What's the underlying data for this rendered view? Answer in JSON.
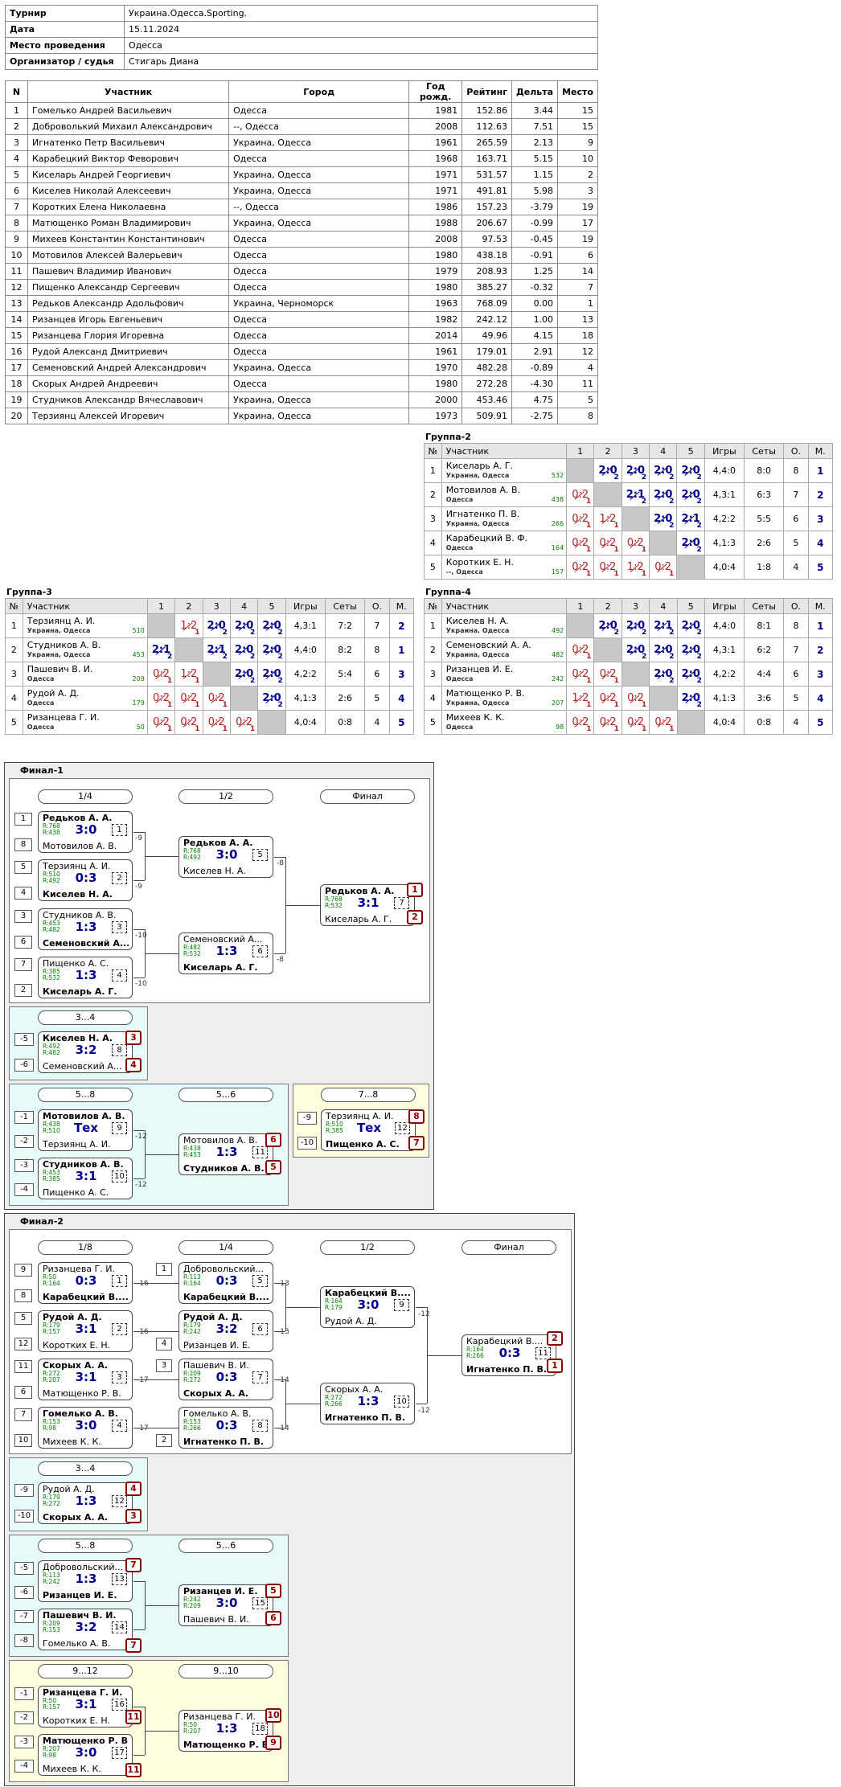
{
  "info": [
    {
      "k": "Турнир",
      "v": "Украина.Одесса.Sporting."
    },
    {
      "k": "Дата",
      "v": "15.11.2024"
    },
    {
      "k": "Место проведения",
      "v": "Одесса"
    },
    {
      "k": "Организатор / судья",
      "v": "Стигарь Диана"
    }
  ],
  "participants": {
    "headers": [
      "N",
      "Участник",
      "Город",
      "Год рожд.",
      "Рейтинг",
      "Дельта",
      "Место"
    ],
    "rows": [
      [
        "1",
        "Гомелько Андрей Васильевич",
        "Одесса",
        "1981",
        "152.86",
        "3.44",
        "15"
      ],
      [
        "2",
        "Доброволький Михаил Александрович",
        "--, Одесса",
        "2008",
        "112.63",
        "7.51",
        "15"
      ],
      [
        "3",
        "Игнатенко Петр Васильевич",
        "Украина, Одесса",
        "1961",
        "265.59",
        "2.13",
        "9"
      ],
      [
        "4",
        "Карабецкий Виктор Феворович",
        "Одесса",
        "1968",
        "163.71",
        "5.15",
        "10"
      ],
      [
        "5",
        "Киселарь Андрей Георгиевич",
        "Украина, Одесса",
        "1971",
        "531.57",
        "1.15",
        "2"
      ],
      [
        "6",
        "Киселев Николай Алексеевич",
        "Украина, Одесса",
        "1971",
        "491.81",
        "5.98",
        "3"
      ],
      [
        "7",
        "Коротких Елена Николаевна",
        "--, Одесса",
        "1986",
        "157.23",
        "-3.79",
        "19"
      ],
      [
        "8",
        "Матющенко Роман Владимирович",
        "Украина, Одесса",
        "1988",
        "206.67",
        "-0.99",
        "17"
      ],
      [
        "9",
        "Михеев Константин Константинович",
        "Одесса",
        "2008",
        "97.53",
        "-0.45",
        "19"
      ],
      [
        "10",
        "Мотовилов Алексей Валерьевич",
        "Одесса",
        "1980",
        "438.18",
        "-0.91",
        "6"
      ],
      [
        "11",
        "Пашевич Владимир Иванович",
        "Одесса",
        "1979",
        "208.93",
        "1.25",
        "14"
      ],
      [
        "12",
        "Пищенко Александр Сергеевич",
        "Одесса",
        "1980",
        "385.27",
        "-0.32",
        "7"
      ],
      [
        "13",
        "Редьков Александр Адольфович",
        "Украина, Черноморск",
        "1963",
        "768.09",
        "0.00",
        "1"
      ],
      [
        "14",
        "Ризанцев Игорь Евгеньевич",
        "Одесса",
        "1982",
        "242.12",
        "1.00",
        "13"
      ],
      [
        "15",
        "Ризанцева Глория Игоревна",
        "Одесса",
        "2014",
        "49.96",
        "4.15",
        "18"
      ],
      [
        "16",
        "Рудой Александ Дмитриевич",
        "Одесса",
        "1961",
        "179.01",
        "2.91",
        "12"
      ],
      [
        "17",
        "Семеновский Андрей Александрович",
        "Украина, Одесса",
        "1970",
        "482.28",
        "-0.89",
        "4"
      ],
      [
        "18",
        "Скорых Андрей Андреевич",
        "Одесса",
        "1980",
        "272.28",
        "-4.30",
        "11"
      ],
      [
        "19",
        "Студников Александр Вячеславович",
        "Украина, Одесса",
        "2000",
        "453.46",
        "4.75",
        "5"
      ],
      [
        "20",
        "Терзиянц Алексей Игоревич",
        "Украина, Одесса",
        "1973",
        "509.91",
        "-2.75",
        "8"
      ]
    ]
  },
  "group_headers": [
    "№",
    "Участник",
    "1",
    "2",
    "3",
    "4",
    "5",
    "Игры",
    "Сеты",
    "О.",
    "М."
  ],
  "groups": [
    {
      "title": "Группа-2",
      "rows": [
        {
          "n": "1",
          "name": "Киселарь А. Г.",
          "city": "Украина, Одесса",
          "rating": "532",
          "res": [
            "",
            "2:0|2|w",
            "2:0|2|w",
            "2:0|2|w",
            "2:0|2|w"
          ],
          "games": "4,4:0",
          "sets": "8:0",
          "pts": "8",
          "place": "1"
        },
        {
          "n": "2",
          "name": "Мотовилов А. В.",
          "city": "Одесса",
          "rating": "438",
          "res": [
            "0:2|1|l",
            "",
            "2:1|2|w",
            "2:0|2|w",
            "2:0|2|w"
          ],
          "games": "4,3:1",
          "sets": "6:3",
          "pts": "7",
          "place": "2"
        },
        {
          "n": "3",
          "name": "Игнатенко П. В.",
          "city": "Украина, Одесса",
          "rating": "266",
          "res": [
            "0:2|1|l",
            "1:2|1|l",
            "",
            "2:0|2|w",
            "2:1|2|w"
          ],
          "games": "4,2:2",
          "sets": "5:5",
          "pts": "6",
          "place": "3"
        },
        {
          "n": "4",
          "name": "Карабецкий В. Ф.",
          "city": "Одесса",
          "rating": "164",
          "res": [
            "0:2|1|l",
            "0:2|1|l",
            "0:2|1|l",
            "",
            "2:0|2|w"
          ],
          "games": "4,1:3",
          "sets": "2:6",
          "pts": "5",
          "place": "4"
        },
        {
          "n": "5",
          "name": "Коротких Е. Н.",
          "city": "--, Одесса",
          "rating": "157",
          "res": [
            "0:2|1|l",
            "0:2|1|l",
            "1:2|1|l",
            "0:2|1|l",
            ""
          ],
          "games": "4,0:4",
          "sets": "1:8",
          "pts": "4",
          "place": "5"
        }
      ]
    },
    {
      "title": "Группа-3",
      "rows": [
        {
          "n": "1",
          "name": "Терзиянц А. И.",
          "city": "Украина, Одесса",
          "rating": "510",
          "res": [
            "",
            "1:2|1|l",
            "2:0|2|w",
            "2:0|2|w",
            "2:0|2|w"
          ],
          "games": "4,3:1",
          "sets": "7:2",
          "pts": "7",
          "place": "2"
        },
        {
          "n": "2",
          "name": "Студников А. В.",
          "city": "Украина, Одесса",
          "rating": "453",
          "res": [
            "2:1|2|w",
            "",
            "2:1|2|w",
            "2:0|2|w",
            "2:0|2|w"
          ],
          "games": "4,4:0",
          "sets": "8:2",
          "pts": "8",
          "place": "1"
        },
        {
          "n": "3",
          "name": "Пашевич В. И.",
          "city": "Одесса",
          "rating": "209",
          "res": [
            "0:2|1|l",
            "1:2|1|l",
            "",
            "2:0|2|w",
            "2:0|2|w"
          ],
          "games": "4,2:2",
          "sets": "5:4",
          "pts": "6",
          "place": "3"
        },
        {
          "n": "4",
          "name": "Рудой А. Д.",
          "city": "Одесса",
          "rating": "179",
          "res": [
            "0:2|1|l",
            "0:2|1|l",
            "0:2|1|l",
            "",
            "2:0|2|w"
          ],
          "games": "4,1:3",
          "sets": "2:6",
          "pts": "5",
          "place": "4"
        },
        {
          "n": "5",
          "name": "Ризанцева Г. И.",
          "city": "Одесса",
          "rating": "50",
          "res": [
            "0:2|1|l",
            "0:2|1|l",
            "0:2|1|l",
            "0:2|1|l",
            ""
          ],
          "games": "4,0:4",
          "sets": "0:8",
          "pts": "4",
          "place": "5"
        }
      ]
    },
    {
      "title": "Группа-4",
      "rows": [
        {
          "n": "1",
          "name": "Киселев Н. А.",
          "city": "Украина, Одесса",
          "rating": "492",
          "res": [
            "",
            "2:0|2|w",
            "2:0|2|w",
            "2:1|2|w",
            "2:0|2|w"
          ],
          "games": "4,4:0",
          "sets": "8:1",
          "pts": "8",
          "place": "1"
        },
        {
          "n": "2",
          "name": "Семеновский А. А.",
          "city": "Украина, Одесса",
          "rating": "482",
          "res": [
            "0:2|1|l",
            "",
            "2:0|2|w",
            "2:0|2|w",
            "2:0|2|w"
          ],
          "games": "4,3:1",
          "sets": "6:2",
          "pts": "7",
          "place": "2"
        },
        {
          "n": "3",
          "name": "Ризанцев И. Е.",
          "city": "Одесса",
          "rating": "242",
          "res": [
            "0:2|1|l",
            "0:2|1|l",
            "",
            "2:0|2|w",
            "2:0|2|w"
          ],
          "games": "4,2:2",
          "sets": "4:4",
          "pts": "6",
          "place": "3"
        },
        {
          "n": "4",
          "name": "Матющенко Р. В.",
          "city": "Украина, Одесса",
          "rating": "207",
          "res": [
            "1:2|1|l",
            "0:2|1|l",
            "0:2|1|l",
            "",
            "2:0|2|w"
          ],
          "games": "4,1:3",
          "sets": "3:6",
          "pts": "5",
          "place": "4"
        },
        {
          "n": "5",
          "name": "Михеев К. К.",
          "city": "Одесса",
          "rating": "98",
          "res": [
            "0:2|1|l",
            "0:2|1|l",
            "0:2|1|l",
            "0:2|1|l",
            ""
          ],
          "games": "4,0:4",
          "sets": "0:8",
          "pts": "4",
          "place": "5"
        }
      ]
    }
  ],
  "final1": {
    "title": "Финал-1",
    "round_labels": [
      "1/4",
      "1/2",
      "Финал",
      "3...4",
      "5...8",
      "5...6",
      "7...8"
    ],
    "seeds": [
      "1",
      "8",
      "5",
      "4",
      "3",
      "6",
      "7",
      "2",
      "-5",
      "-6",
      "-1",
      "-2",
      "-3",
      "-4",
      "-9",
      "-10"
    ],
    "losers": [
      "-9",
      "-9",
      "-10",
      "-10",
      "-8",
      "-8",
      "-12",
      "-12"
    ],
    "places": [
      "1",
      "2",
      "3",
      "4",
      "6",
      "5",
      "8",
      "7"
    ],
    "matches": [
      {
        "p1": "Редьков А. А.",
        "r1": "R:768",
        "p2": "Мотовилов А. В.",
        "r2": "R:438",
        "score": "3:0",
        "num": "1",
        "w": 1
      },
      {
        "p1": "Терзиянц А. И.",
        "r1": "R:510",
        "p2": "Киселев Н. А.",
        "r2": "R:492",
        "score": "0:3",
        "num": "2",
        "w": 2
      },
      {
        "p1": "Студников А. В.",
        "r1": "R:453",
        "p2": "Семеновский А...",
        "r2": "R:482",
        "score": "1:3",
        "num": "3",
        "w": 2
      },
      {
        "p1": "Пищенко А. С.",
        "r1": "R:385",
        "p2": "Киселарь А. Г.",
        "r2": "R:532",
        "score": "1:3",
        "num": "4",
        "w": 2
      },
      {
        "p1": "Редьков А. А.",
        "r1": "R:768",
        "p2": "Киселев Н. А.",
        "r2": "R:492",
        "score": "3:0",
        "num": "5",
        "w": 1
      },
      {
        "p1": "Семеновский А...",
        "r1": "R:482",
        "p2": "Киселарь А. Г.",
        "r2": "R:532",
        "score": "1:3",
        "num": "6",
        "w": 2
      },
      {
        "p1": "Редьков А. А.",
        "r1": "R:768",
        "p2": "Киселарь А. Г.",
        "r2": "R:532",
        "score": "3:1",
        "num": "7",
        "w": 1
      },
      {
        "p1": "Киселев Н. А.",
        "r1": "R:492",
        "p2": "Семеновский А...",
        "r2": "R:482",
        "score": "3:2",
        "num": "8",
        "w": 1
      },
      {
        "p1": "Мотовилов А. В.",
        "r1": "R:438",
        "p2": "Терзиянц А. И.",
        "r2": "R:510",
        "score": "Тех",
        "num": "9",
        "w": 1
      },
      {
        "p1": "Студников А. В.",
        "r1": "R:453",
        "p2": "Пищенко А. С.",
        "r2": "R:385",
        "score": "3:1",
        "num": "10",
        "w": 1
      },
      {
        "p1": "Мотовилов А. В.",
        "r1": "R:438",
        "p2": "Студников А. В.",
        "r2": "R:453",
        "score": "1:3",
        "num": "11",
        "w": 2
      },
      {
        "p1": "Терзиянц А. И.",
        "r1": "R:510",
        "p2": "Пищенко А. С.",
        "r2": "R:385",
        "score": "Тех",
        "num": "12",
        "w": 2
      }
    ]
  },
  "final2": {
    "title": "Финал-2",
    "round_labels": [
      "1/8",
      "1/4",
      "1/2",
      "Финал",
      "3...4",
      "5...8",
      "5...6",
      "9...12",
      "9...10"
    ],
    "seeds": [
      "9",
      "8",
      "5",
      "12",
      "11",
      "6",
      "7",
      "10",
      "1",
      "4",
      "3",
      "2",
      "-9",
      "-10",
      "-5",
      "-6",
      "-7",
      "-8",
      "-1",
      "-2",
      "-3",
      "-4"
    ],
    "losers": [
      "-16",
      "-16",
      "-17",
      "-17",
      "-13",
      "-13",
      "-14",
      "-14",
      "-12",
      "-12"
    ],
    "places": [
      "2",
      "1",
      "4",
      "3",
      "7",
      "7",
      "5",
      "6",
      "11",
      "11",
      "10",
      "9"
    ],
    "matches": [
      {
        "p1": "Ризанцева Г. И.",
        "r1": "R:50",
        "p2": "Карабецкий В....",
        "r2": "R:164",
        "score": "0:3",
        "num": "1",
        "w": 2
      },
      {
        "p1": "Рудой А. Д.",
        "r1": "R:179",
        "p2": "Коротких Е. Н.",
        "r2": "R:157",
        "score": "3:1",
        "num": "2",
        "w": 1
      },
      {
        "p1": "Скорых А. А.",
        "r1": "R:272",
        "p2": "Матющенко Р. В.",
        "r2": "R:207",
        "score": "3:1",
        "num": "3",
        "w": 1
      },
      {
        "p1": "Гомелько А. В.",
        "r1": "R:153",
        "p2": "Михеев К. К.",
        "r2": "R:98",
        "score": "3:0",
        "num": "4",
        "w": 1
      },
      {
        "p1": "Добровольский...",
        "r1": "R:113",
        "p2": "Карабецкий В....",
        "r2": "R:164",
        "score": "0:3",
        "num": "5",
        "w": 2
      },
      {
        "p1": "Рудой А. Д.",
        "r1": "R:179",
        "p2": "Ризанцев И. Е.",
        "r2": "R:242",
        "score": "3:2",
        "num": "6",
        "w": 1
      },
      {
        "p1": "Пашевич В. И.",
        "r1": "R:209",
        "p2": "Скорых А. А.",
        "r2": "R:272",
        "score": "0:3",
        "num": "7",
        "w": 2
      },
      {
        "p1": "Гомелько А. В.",
        "r1": "R:153",
        "p2": "Игнатенко П. В.",
        "r2": "R:266",
        "score": "0:3",
        "num": "8",
        "w": 2
      },
      {
        "p1": "Карабецкий В....",
        "r1": "R:164",
        "p2": "Рудой А. Д.",
        "r2": "R:179",
        "score": "3:0",
        "num": "9",
        "w": 1
      },
      {
        "p1": "Скорых А. А.",
        "r1": "R:272",
        "p2": "Игнатенко П. В.",
        "r2": "R:266",
        "score": "1:3",
        "num": "10",
        "w": 2
      },
      {
        "p1": "Карабецкий В....",
        "r1": "R:164",
        "p2": "Игнатенко П. В.",
        "r2": "R:266",
        "score": "0:3",
        "num": "11",
        "w": 2
      },
      {
        "p1": "Рудой А. Д.",
        "r1": "R:179",
        "p2": "Скорых А. А.",
        "r2": "R:272",
        "score": "1:3",
        "num": "12",
        "w": 2
      },
      {
        "p1": "Добровольский...",
        "r1": "R:113",
        "p2": "Ризанцев И. Е.",
        "r2": "R:242",
        "score": "1:3",
        "num": "13",
        "w": 2
      },
      {
        "p1": "Пашевич В. И.",
        "r1": "R:209",
        "p2": "Гомелько А. В.",
        "r2": "R:153",
        "score": "3:2",
        "num": "14",
        "w": 1
      },
      {
        "p1": "Ризанцев И. Е.",
        "r1": "R:242",
        "p2": "Пашевич В. И.",
        "r2": "R:209",
        "score": "3:0",
        "num": "15",
        "w": 1
      },
      {
        "p1": "Ризанцева Г. И.",
        "r1": "R:50",
        "p2": "Коротких Е. Н.",
        "r2": "R:157",
        "score": "3:1",
        "num": "16",
        "w": 1
      },
      {
        "p1": "Матющенко Р. В.",
        "r1": "R:207",
        "p2": "Михеев К. К.",
        "r2": "R:98",
        "score": "3:0",
        "num": "17",
        "w": 1
      },
      {
        "p1": "Ризанцева Г. И.",
        "r1": "R:50",
        "p2": "Матющенко Р. В.",
        "r2": "R:207",
        "score": "1:3",
        "num": "18",
        "w": 2
      }
    ]
  }
}
